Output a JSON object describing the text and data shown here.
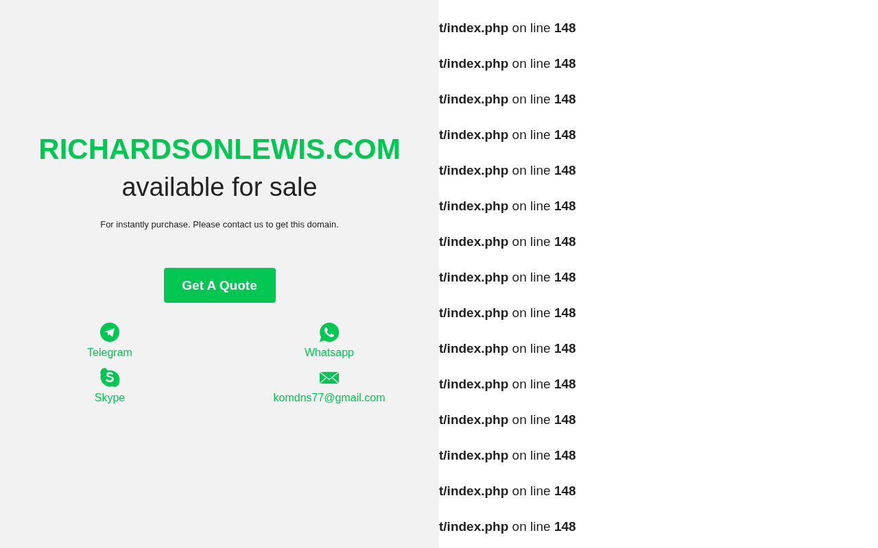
{
  "sale_panel": {
    "domain": "RICHARDSONLEWIS.COM",
    "headline": "available for sale",
    "message": "For instantly purchase. Please contact us to get this domain.",
    "button": "Get A Quote",
    "contacts": [
      {
        "kind": "telegram",
        "label": "Telegram"
      },
      {
        "kind": "whatsapp",
        "label": "Whatsapp"
      },
      {
        "kind": "skype",
        "label": "Skype"
      },
      {
        "kind": "email",
        "label": "komdns77@gmail.com"
      }
    ]
  },
  "error_lines": [
    "**t/index.php** on line **148**",
    "**t/index.php** on line **148**",
    "**t/index.php** on line **148**",
    "**t/index.php** on line **148**",
    "**t/index.php** on line **148**",
    "**t/index.php** on line **148**",
    "**t/index.php** on line **148**",
    "**t/index.php** on line **148**",
    "**t/index.php** on line **148**",
    "**t/index.php** on line **148**",
    "**t/index.php** on line **148**",
    "**t/index.php** on line **148**",
    "**t/index.php** on line **148**",
    "**t/index.php** on line **148**",
    "**t/index.php** on line **148**"
  ]
}
